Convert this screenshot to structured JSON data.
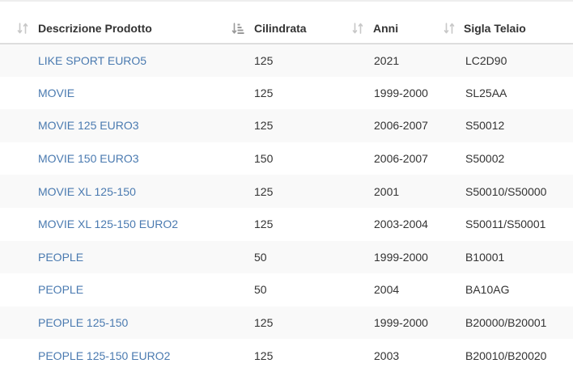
{
  "table": {
    "columns": [
      {
        "key": "descrizione",
        "label": "Descrizione Prodotto",
        "sort": "both"
      },
      {
        "key": "cilindrata",
        "label": "Cilindrata",
        "sort": "asc"
      },
      {
        "key": "anni",
        "label": "Anni",
        "sort": "both"
      },
      {
        "key": "sigla",
        "label": "Sigla Telaio",
        "sort": "both"
      }
    ],
    "rows": [
      {
        "descrizione": "LIKE SPORT EURO5",
        "cilindrata": "125",
        "anni": "2021",
        "sigla": "LC2D90"
      },
      {
        "descrizione": "MOVIE",
        "cilindrata": "125",
        "anni": "1999-2000",
        "sigla": "SL25AA"
      },
      {
        "descrizione": "MOVIE 125 EURO3",
        "cilindrata": "125",
        "anni": "2006-2007",
        "sigla": "S50012"
      },
      {
        "descrizione": "MOVIE 150 EURO3",
        "cilindrata": "150",
        "anni": "2006-2007",
        "sigla": "S50002"
      },
      {
        "descrizione": "MOVIE XL 125-150",
        "cilindrata": "125",
        "anni": "2001",
        "sigla": "S50010/S50000"
      },
      {
        "descrizione": "MOVIE XL 125-150 EURO2",
        "cilindrata": "125",
        "anni": "2003-2004",
        "sigla": "S50011/S50001"
      },
      {
        "descrizione": "PEOPLE",
        "cilindrata": "50",
        "anni": "1999-2000",
        "sigla": "B10001"
      },
      {
        "descrizione": "PEOPLE",
        "cilindrata": "50",
        "anni": "2004",
        "sigla": "BA10AG"
      },
      {
        "descrizione": "PEOPLE 125-150",
        "cilindrata": "125",
        "anni": "1999-2000",
        "sigla": "B20000/B20001"
      },
      {
        "descrizione": "PEOPLE 125-150 EURO2",
        "cilindrata": "125",
        "anni": "2003",
        "sigla": "B20010/B20020"
      }
    ]
  },
  "colors": {
    "link": "#4a7ab0",
    "text": "#333333",
    "stripe": "#f9f9f9",
    "header_border": "#dddddd",
    "sort_icon": "#c8c8c8",
    "sort_icon_active": "#9a9a9a"
  }
}
